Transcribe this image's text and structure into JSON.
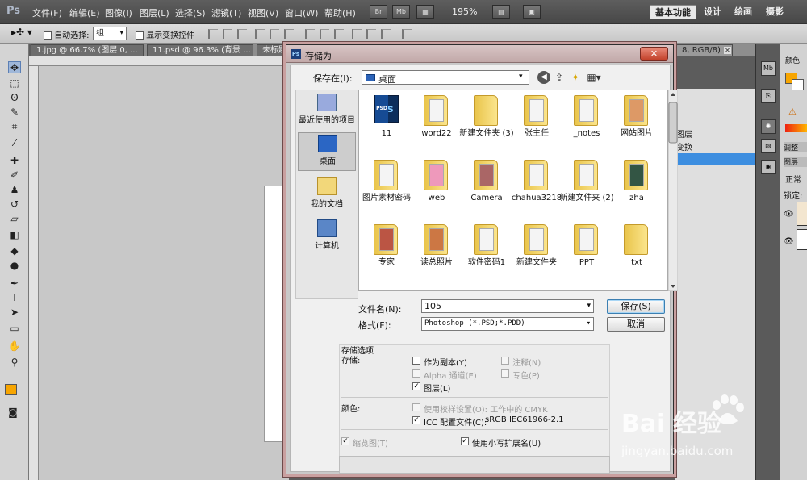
{
  "app": {
    "logo": "Ps",
    "menus": [
      "文件(F)",
      "编辑(E)",
      "图像(I)",
      "图层(L)",
      "选择(S)",
      "滤镜(T)",
      "视图(V)",
      "窗口(W)",
      "帮助(H)"
    ],
    "mini_buttons": [
      "Br",
      "Mb"
    ],
    "zoom": "195%",
    "workspaces": [
      "基本功能",
      "设计",
      "绘画",
      "摄影"
    ]
  },
  "options_bar": {
    "auto_select_label": "自动选择:",
    "auto_select_value": "组",
    "show_transform_label": "显示变换控件"
  },
  "doc_tabs": [
    {
      "label": "1.jpg @ 66.7% (图层 0, ..."
    },
    {
      "label": "11.psd @ 96.3% (背景 ..."
    },
    {
      "label": "未标题..."
    },
    {
      "label": "8, RGB/8)"
    }
  ],
  "right_panel": {
    "color_tab": "颜色",
    "adjust_tab": "调整",
    "layers_tab": "图层",
    "blend_mode": "正常",
    "lock_label": "锁定:",
    "panel_labels": [
      "图层",
      "变换"
    ]
  },
  "dialog": {
    "title": "存储为",
    "close": "✕",
    "save_in_label": "保存在(I):",
    "location": "桌面",
    "places": [
      {
        "label": "最近使用的项目"
      },
      {
        "label": "桌面"
      },
      {
        "label": "我的文档"
      },
      {
        "label": "计算机"
      }
    ],
    "files": [
      {
        "name": "11",
        "kind": "psd"
      },
      {
        "name": "word22",
        "kind": "folder"
      },
      {
        "name": "新建文件夹 (3)",
        "kind": "folder"
      },
      {
        "name": "张主任",
        "kind": "folder"
      },
      {
        "name": "_notes",
        "kind": "folder"
      },
      {
        "name": "网站图片",
        "kind": "folder"
      },
      {
        "name": "图片素材密码",
        "kind": "folder"
      },
      {
        "name": "web",
        "kind": "folder"
      },
      {
        "name": "Camera",
        "kind": "folder"
      },
      {
        "name": "chahua3218",
        "kind": "folder"
      },
      {
        "name": "新建文件夹 (2)",
        "kind": "folder"
      },
      {
        "name": "zha",
        "kind": "folder"
      },
      {
        "name": "专家",
        "kind": "folder"
      },
      {
        "name": "读总照片",
        "kind": "folder"
      },
      {
        "name": "软件密码1",
        "kind": "folder"
      },
      {
        "name": "新建文件夹",
        "kind": "folder"
      },
      {
        "name": "PPT",
        "kind": "folder"
      },
      {
        "name": "txt",
        "kind": "folder"
      }
    ],
    "filename_label": "文件名(N):",
    "filename_value": "105",
    "format_label": "格式(F):",
    "format_value": "Photoshop (*.PSD;*.PDD)",
    "save_button": "保存(S)",
    "cancel_button": "取消",
    "options": {
      "section_title": "存储选项",
      "store_label": "存储:",
      "as_copy": "作为副本(Y)",
      "notes": "注释(N)",
      "alpha": "Alpha 通道(E)",
      "spot": "专色(P)",
      "layers": "图层(L)",
      "color_label": "颜色:",
      "proof": "使用校样设置(O): 工作中的 CMYK",
      "icc": "ICC 配置文件(C):",
      "icc_value": "sRGB IEC61966-2.1",
      "thumbnail": "缩览图(T)",
      "lowercase": "使用小写扩展名(U)",
      "checked": {
        "as_copy": false,
        "notes": false,
        "alpha": false,
        "spot": false,
        "layers": true,
        "proof": false,
        "icc": true,
        "thumbnail": true,
        "lowercase": true
      }
    }
  },
  "watermark": {
    "logo": "Bai  经验",
    "url": "jingyan.baidu.com"
  }
}
